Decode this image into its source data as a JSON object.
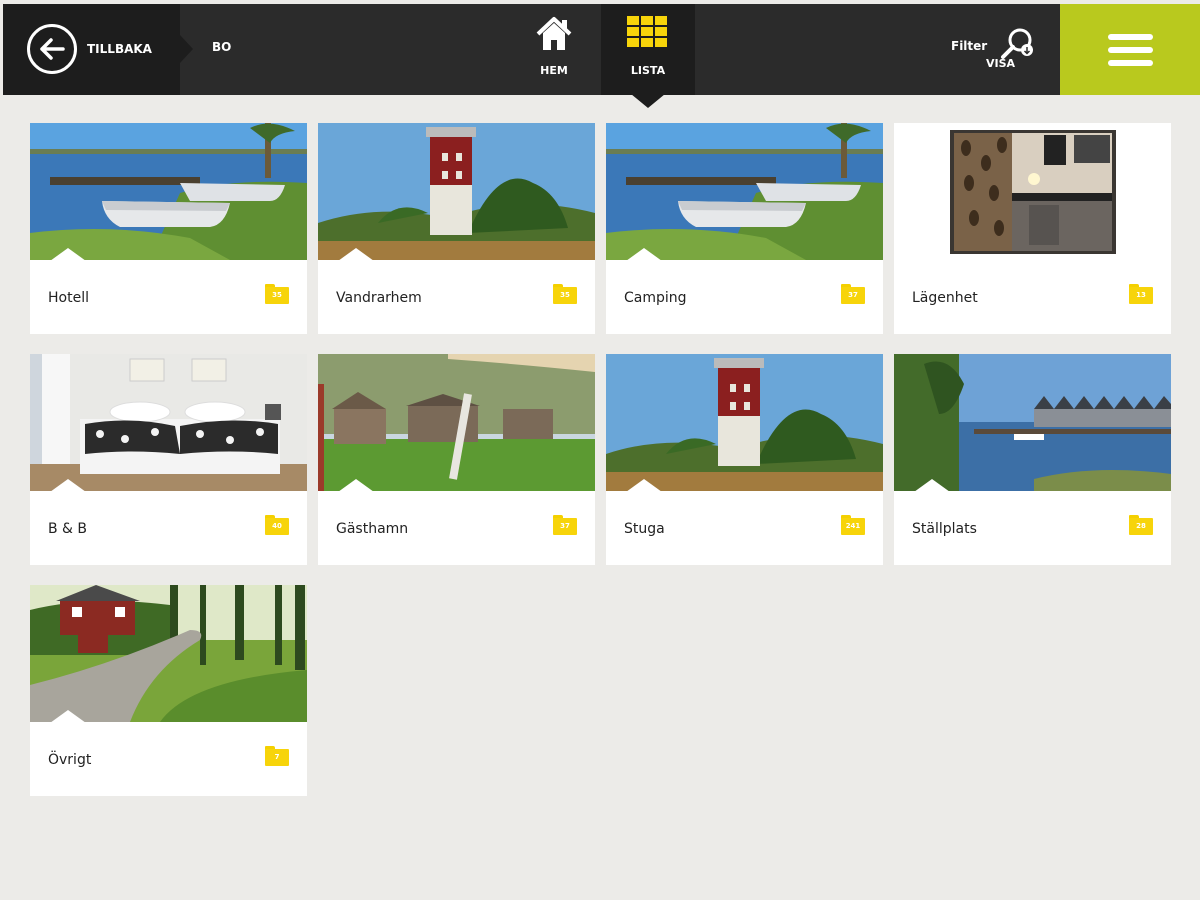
{
  "header": {
    "back_label": "TILLBAKA",
    "breadcrumb": "BO",
    "tabs": [
      {
        "label": "HEM",
        "icon": "home-icon"
      },
      {
        "label": "LISTA",
        "icon": "grid-icon",
        "active": true
      }
    ],
    "filter_label": "Filter",
    "filter_sub": "VISA",
    "menu_icon": "hamburger-icon",
    "accent": "#b9c91e",
    "grid_color": "#f7d40a"
  },
  "categories": [
    {
      "title": "Hotell",
      "count": "35",
      "image": "boats-on-lake"
    },
    {
      "title": "Vandrarhem",
      "count": "35",
      "image": "lighthouse"
    },
    {
      "title": "Camping",
      "count": "37",
      "image": "boats-on-lake"
    },
    {
      "title": "Lägenhet",
      "count": "13",
      "image": "apartment-kitchen"
    },
    {
      "title": "B & B",
      "count": "40",
      "image": "bedroom"
    },
    {
      "title": "Gästhamn",
      "count": "37",
      "image": "cabins-lawn"
    },
    {
      "title": "Stuga",
      "count": "241",
      "image": "lighthouse"
    },
    {
      "title": "Ställplats",
      "count": "28",
      "image": "harbor-houses"
    },
    {
      "title": "Övrigt",
      "count": "7",
      "image": "forest-road-cottage"
    }
  ]
}
